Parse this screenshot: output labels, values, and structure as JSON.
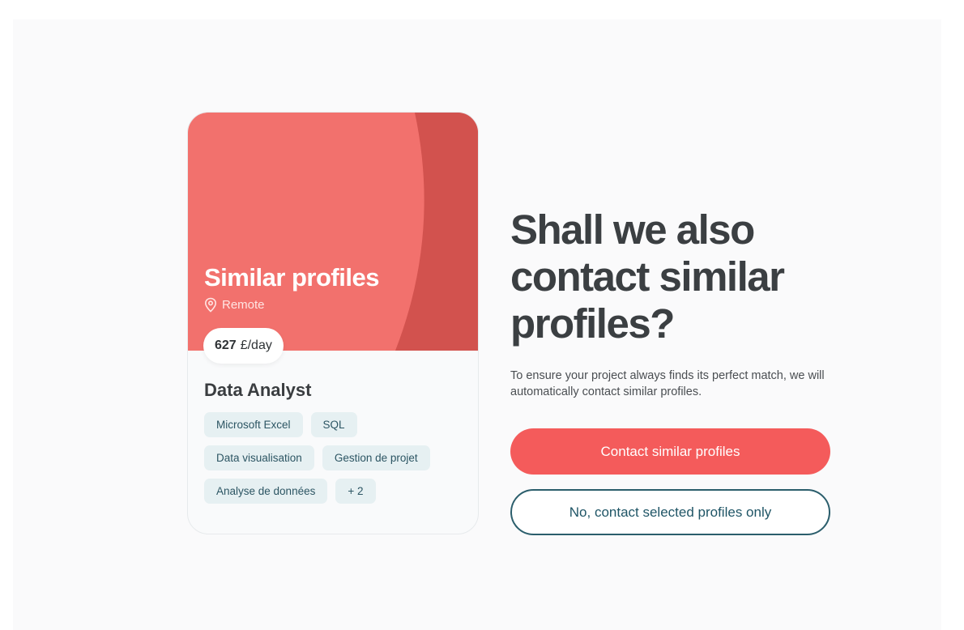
{
  "card": {
    "hero_title": "Similar profiles",
    "location": "Remote",
    "location_icon": "map-pin-icon",
    "rate_amount": "627",
    "rate_unit": "£/day",
    "job_title": "Data Analyst",
    "tags": [
      "Microsoft Excel",
      "SQL",
      "Data visualisation",
      "Gestion de projet",
      "Analyse de données",
      "+ 2"
    ],
    "hero_color": "#f2716d",
    "hero_accent_color": "#d2524e"
  },
  "prompt": {
    "headline": "Shall we also contact similar profiles?",
    "description": "To ensure your project always finds its perfect match, we will automatically contact similar profiles."
  },
  "actions": {
    "primary_label": "Contact similar profiles",
    "secondary_label": "No, contact selected profiles only",
    "primary_color": "#f45b5b",
    "secondary_border_color": "#2b5e6c"
  }
}
